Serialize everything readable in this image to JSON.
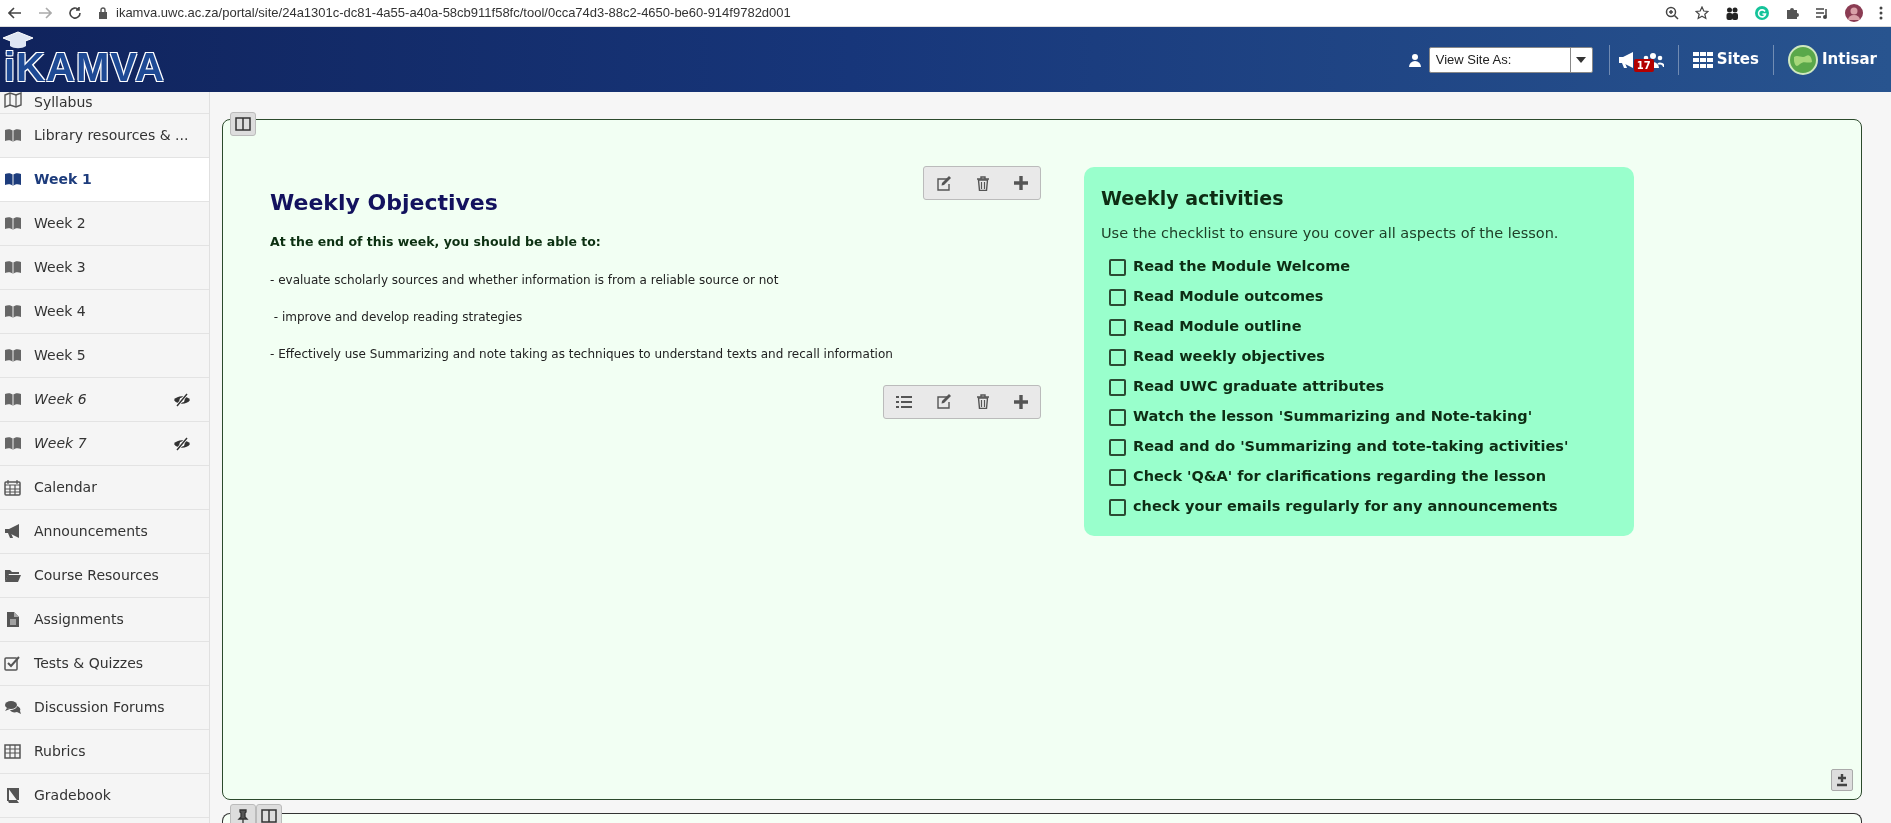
{
  "browser": {
    "url": "ikamva.uwc.ac.za/portal/site/24a1301c-dc81-4a55-a40a-58cb911f58fc/tool/0cca74d3-88c2-4650-be60-914f9782d001"
  },
  "header": {
    "logo": "iKAMVA",
    "view_site_as": {
      "value": "View Site As:"
    },
    "notifications_count": "17",
    "sites_label": "Sites",
    "user_name": "Intisar"
  },
  "sidebar": {
    "items": [
      {
        "label": "Syllabus",
        "kind": "map",
        "selected": false,
        "hidden": false
      },
      {
        "label": "Library resources & ...",
        "kind": "book",
        "selected": false,
        "hidden": false
      },
      {
        "label": "Week 1",
        "kind": "book",
        "selected": true,
        "hidden": false
      },
      {
        "label": "Week 2",
        "kind": "book",
        "selected": false,
        "hidden": false
      },
      {
        "label": "Week 3",
        "kind": "book",
        "selected": false,
        "hidden": false
      },
      {
        "label": "Week 4",
        "kind": "book",
        "selected": false,
        "hidden": false
      },
      {
        "label": "Week 5",
        "kind": "book",
        "selected": false,
        "hidden": false
      },
      {
        "label": "Week 6",
        "kind": "book",
        "selected": false,
        "hidden": true
      },
      {
        "label": "Week 7",
        "kind": "book",
        "selected": false,
        "hidden": true
      },
      {
        "label": "Calendar",
        "kind": "calendar",
        "selected": false,
        "hidden": false
      },
      {
        "label": "Announcements",
        "kind": "megaphone",
        "selected": false,
        "hidden": false
      },
      {
        "label": "Course Resources",
        "kind": "folder",
        "selected": false,
        "hidden": false
      },
      {
        "label": "Assignments",
        "kind": "file",
        "selected": false,
        "hidden": false
      },
      {
        "label": "Tests & Quizzes",
        "kind": "checkbox",
        "selected": false,
        "hidden": false
      },
      {
        "label": "Discussion Forums",
        "kind": "chat",
        "selected": false,
        "hidden": false
      },
      {
        "label": "Rubrics",
        "kind": "table",
        "selected": false,
        "hidden": false
      },
      {
        "label": "Gradebook",
        "kind": "gradebook",
        "selected": false,
        "hidden": false
      }
    ]
  },
  "objectives": {
    "title": "Weekly Objectives",
    "intro": "At the end of this week, you should be able to:",
    "points": [
      "- evaluate scholarly sources and whether information is from a reliable source or not",
      " - improve and develop reading strategies",
      "- Effectively use Summarizing and note taking as techniques to understand texts and recall information"
    ]
  },
  "activities": {
    "title": "Weekly activities",
    "description": "Use the checklist to ensure you cover all aspects of the lesson.",
    "checklist": [
      {
        "label": "Read the Module Welcome",
        "checked": false
      },
      {
        "label": "Read Module outcomes",
        "checked": false
      },
      {
        "label": "Read Module outline",
        "checked": false
      },
      {
        "label": "Read weekly objectives",
        "checked": false
      },
      {
        "label": "Read UWC graduate attributes",
        "checked": false
      },
      {
        "label": "Watch the lesson 'Summarizing and Note-taking'",
        "checked": false
      },
      {
        "label": "Read and do 'Summarizing and tote-taking activities'",
        "checked": false
      },
      {
        "label": "Check 'Q&A' for clarifications regarding the lesson",
        "checked": false
      },
      {
        "label": "check your emails regularly for any announcements",
        "checked": false
      }
    ]
  }
}
